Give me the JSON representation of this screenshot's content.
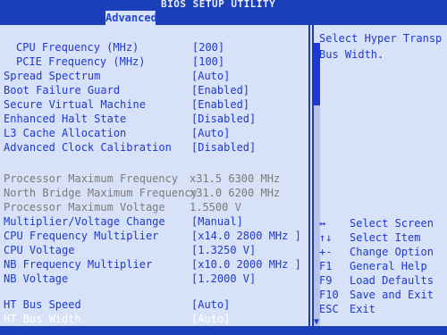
{
  "app": {
    "title": "BIOS SETUP UTILITY"
  },
  "tabs": [
    {
      "label": "Advanced"
    }
  ],
  "settings": {
    "cpu_frequency": {
      "label": "CPU Frequency (MHz)",
      "value": "[200]"
    },
    "pcie_frequency": {
      "label": "PCIE Frequency (MHz)",
      "value": "[100]"
    },
    "spread_spectrum": {
      "label": "Spread Spectrum",
      "value": "[Auto]"
    },
    "boot_failure_guard": {
      "label": "Boot Failure Guard",
      "value": "[Enabled]"
    },
    "secure_virtual_machine": {
      "label": "Secure Virtual Machine",
      "value": "[Enabled]"
    },
    "enhanced_halt_state": {
      "label": "Enhanced Halt State",
      "value": "[Disabled]"
    },
    "l3_cache_allocation": {
      "label": "L3 Cache Allocation",
      "value": "[Auto]"
    },
    "advanced_clock_calibration": {
      "label": "Advanced Clock Calibration",
      "value": "[Disabled]"
    },
    "processor_max_frequency": {
      "label": "Processor Maximum Frequency",
      "value": "x31.5 6300 MHz"
    },
    "northbridge_max_frequency": {
      "label": "North Bridge Maximum Frequency",
      "value": "x31.0 6200 MHz"
    },
    "processor_max_voltage": {
      "label": "Processor Maximum Voltage",
      "value": "1.5500 V"
    },
    "multiplier_voltage_change": {
      "label": "Multiplier/Voltage Change",
      "value": "[Manual]"
    },
    "cpu_frequency_multiplier": {
      "label": "CPU Frequency Multiplier",
      "value": "[x14.0 2800 MHz ]"
    },
    "cpu_voltage": {
      "label": "CPU Voltage",
      "value": "[1.3250 V]"
    },
    "nb_frequency_multiplier": {
      "label": "NB Frequency Multiplier",
      "value": "[x10.0 2000 MHz ]"
    },
    "nb_voltage": {
      "label": "NB Voltage",
      "value": "[1.2000 V]"
    },
    "ht_bus_speed": {
      "label": "HT Bus Speed",
      "value": "[Auto]"
    },
    "ht_bus_width": {
      "label": "HT Bus Width",
      "value": "[Auto]"
    }
  },
  "help": {
    "text": "Select Hyper Transp\nBus Width."
  },
  "keys": [
    {
      "key": "↔",
      "desc": "Select Screen"
    },
    {
      "key": "↑↓",
      "desc": "Select Item"
    },
    {
      "key": "+-",
      "desc": "Change Option"
    },
    {
      "key": "F1",
      "desc": "General Help"
    },
    {
      "key": "F9",
      "desc": "Load Defaults"
    },
    {
      "key": "F10",
      "desc": "Save and Exit"
    },
    {
      "key": "ESC",
      "desc": "Exit"
    }
  ],
  "colors": {
    "frame_blue": "#1b3fb8",
    "panel_bg": "#d7e1f7",
    "text_blue": "#1f3ad1",
    "dim_gray": "#7b7b7b",
    "highlight_white": "#ffffff"
  }
}
